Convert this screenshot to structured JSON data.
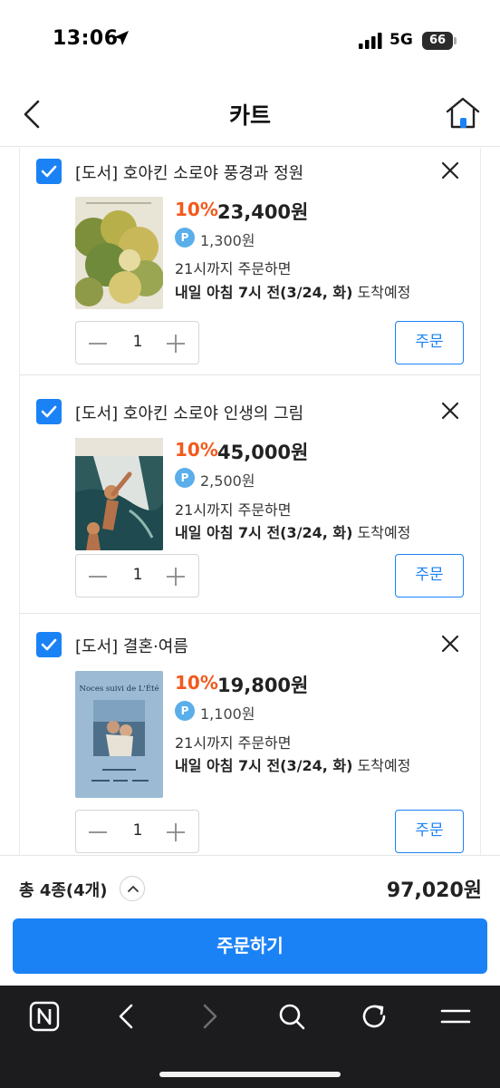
{
  "status_bar": {
    "time": "13:06",
    "network": "5G",
    "battery": "66"
  },
  "header": {
    "title": "카트"
  },
  "cart": {
    "items": [
      {
        "title": "[도서] 호아킨 소로야 풍경과 정원",
        "discount": "10%",
        "price": "23,400원",
        "points_badge": "P",
        "points": "1,300원",
        "delivery_condition": "21시까지 주문하면",
        "delivery_time": "내일 아침 7시 전(3/24, 화)",
        "delivery_suffix": "도착예정",
        "quantity": "1",
        "order_label": "주문"
      },
      {
        "title": "[도서] 호아킨 소로야 인생의 그림",
        "discount": "10%",
        "price": "45,000원",
        "points_badge": "P",
        "points": "2,500원",
        "delivery_condition": "21시까지 주문하면",
        "delivery_time": "내일 아침 7시 전(3/24, 화)",
        "delivery_suffix": "도착예정",
        "quantity": "1",
        "order_label": "주문"
      },
      {
        "title": "[도서] 결혼·여름",
        "cover_title": "Noces suivi de L'Été",
        "discount": "10%",
        "price": "19,800원",
        "points_badge": "P",
        "points": "1,100원",
        "delivery_condition": "21시까지 주문하면",
        "delivery_time": "내일 아침 7시 전(3/24, 화)",
        "delivery_suffix": "도착예정",
        "quantity": "1",
        "order_label": "주문"
      }
    ]
  },
  "summary": {
    "count_label": "총 4종(4개)",
    "total": "97,020원",
    "checkout_label": "주문하기"
  },
  "colors": {
    "accent": "#1b82f6",
    "discount": "#f25a1e",
    "points": "#5aaeea",
    "toolbar": "#1c1c1e"
  },
  "icons": [
    "location-arrow-icon",
    "signal-icon",
    "battery-icon",
    "back-chevron-icon",
    "home-icon",
    "checkbox-checked-icon",
    "close-icon",
    "minus-icon",
    "plus-icon",
    "chevron-up-icon",
    "naver-n-icon",
    "back-icon",
    "forward-icon",
    "search-icon",
    "refresh-icon",
    "menu-icon"
  ]
}
